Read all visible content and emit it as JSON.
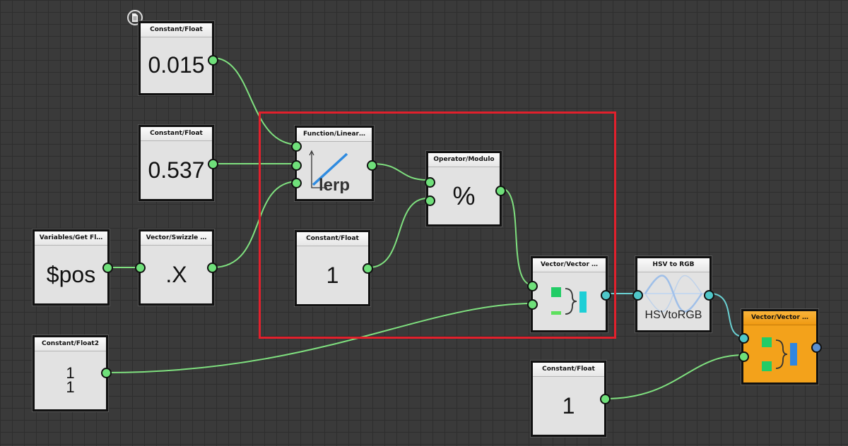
{
  "graph": {
    "nodes": {
      "const_0015": {
        "title": "Constant/Float",
        "value": "0.015"
      },
      "const_0537": {
        "title": "Constant/Float",
        "value": "0.537"
      },
      "get_var": {
        "title": "Variables/Get Fl…",
        "value": "$pos"
      },
      "swizzle": {
        "title": "Vector/Swizzle …",
        "value": ".X"
      },
      "lerp": {
        "title": "Function/Linear…",
        "value": "lerp"
      },
      "modulo": {
        "title": "Operator/Modulo",
        "value": "%"
      },
      "const_1a": {
        "title": "Constant/Float",
        "value": "1"
      },
      "const_float2": {
        "title": "Constant/Float2",
        "value_top": "1",
        "value_bottom": "1"
      },
      "vector_a": {
        "title": "Vector/Vector …"
      },
      "hsv": {
        "title": "HSV to RGB",
        "value": "HSVtoRGB"
      },
      "const_1b": {
        "title": "Constant/Float",
        "value": "1"
      },
      "vector_b": {
        "title": "Vector/Vector …"
      }
    }
  },
  "colors": {
    "wire_green": "#7fe07f",
    "wire_cyan": "#6ad0d2",
    "selection": "#e2202c",
    "accent_orange": "#f3a21b"
  },
  "icons": {
    "document": "document-icon",
    "lerp": "lerp-graph-icon",
    "combine": "vector-combine-icon",
    "hsv": "sine-wave-icon"
  }
}
